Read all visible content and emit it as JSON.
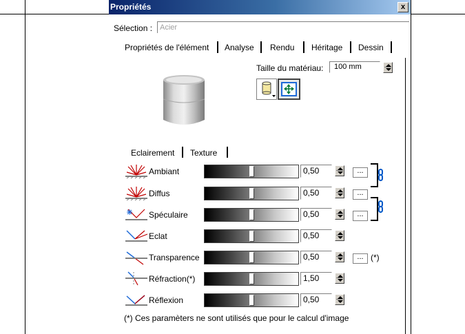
{
  "window": {
    "title": "Propriétés",
    "close_glyph": "x"
  },
  "selection": {
    "label": "Sélection :",
    "value": "Acier"
  },
  "tabs": [
    "Propriétés de l'élément",
    "Analyse",
    "Rendu",
    "Héritage",
    "Dessin"
  ],
  "material": {
    "label": "Taille du matériau:",
    "value": "100 mm"
  },
  "subtabs": [
    "Eclairement",
    "Texture"
  ],
  "rows": [
    {
      "label": "Ambiant",
      "value": "0,50",
      "level": 0.5,
      "has_dots": true,
      "dots": "..."
    },
    {
      "label": "Diffus",
      "value": "0,50",
      "level": 0.5,
      "has_dots": true,
      "dots": "..."
    },
    {
      "label": "Spéculaire",
      "value": "0,50",
      "level": 0.5,
      "has_dots": true,
      "dots": "..."
    },
    {
      "label": "Eclat",
      "value": "0,50",
      "level": 0.5,
      "has_dots": false
    },
    {
      "label": "Transparence",
      "value": "0,50",
      "level": 0.5,
      "has_dots": true,
      "dots": "...",
      "note": "(*)"
    },
    {
      "label": "Réfraction(*)",
      "value": "1,50",
      "level": 0.5,
      "has_dots": false
    },
    {
      "label": "Réflexion",
      "value": "0,50",
      "level": 0.5,
      "has_dots": false
    }
  ],
  "footnote": "(*) Ces paramèters ne sont utilisés que pour le calcul d'image",
  "icons": {
    "ambient": "ambient-light-icon",
    "diffuse": "diffuse-light-icon",
    "specular": "specular-light-icon",
    "shine": "shine-icon",
    "transparency": "transparency-icon",
    "refraction": "refraction-icon",
    "reflection": "reflection-icon",
    "link": "chain-link-icon",
    "cylinder": "cylinder-mapping-icon",
    "fit": "fit-arrows-icon"
  },
  "colors": {
    "titlebar_start": "#0a246a",
    "titlebar_end": "#a6caf0",
    "icon_red": "#c00000",
    "icon_blue": "#1e6ad8",
    "link_blue": "#0058c8"
  }
}
